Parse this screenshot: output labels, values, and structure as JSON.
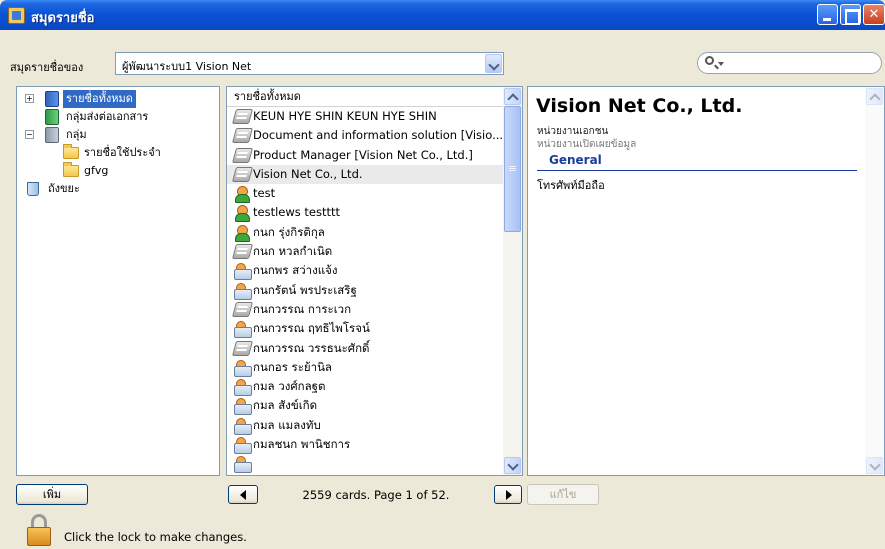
{
  "window": {
    "title": "สมุดรายชื่อ"
  },
  "addressbook": {
    "label": "สมุดรายชื่อของ",
    "selected": "ผู้พัฒนาระบบ1 Vision Net"
  },
  "groups": {
    "items": [
      {
        "label": "รายชื่อทั้งหมด",
        "selected": true
      },
      {
        "label": "กลุ่มส่งต่อเอกสาร"
      },
      {
        "label": "กลุ่ม"
      },
      {
        "label": "รายชื่อใช้ประจำ"
      },
      {
        "label": "gfvg"
      },
      {
        "label": "ถังขยะ"
      }
    ]
  },
  "contacts": {
    "header": "รายชื่อทั้งหมด",
    "rows": [
      {
        "name": "KEUN HYE SHIN KEUN HYE SHIN",
        "icon": "org-icon"
      },
      {
        "name": "Document and information solution [Visio...",
        "icon": "org-icon"
      },
      {
        "name": "Product Manager [Vision Net Co., Ltd.]",
        "icon": "org-icon"
      },
      {
        "name": "Vision Net Co., Ltd.",
        "icon": "org-icon",
        "highlight": true
      },
      {
        "name": "test",
        "icon": "person-icon"
      },
      {
        "name": "testlews testttt",
        "icon": "person-icon"
      },
      {
        "name": "กนก รุ่งกิรติกุล",
        "icon": "person-icon"
      },
      {
        "name": "กนก หวลกำเนิด",
        "icon": "org-icon"
      },
      {
        "name": "กนกพร สว่างแจ้ง",
        "icon": "card-icon"
      },
      {
        "name": "กนกรัตน์ พรประเสริฐ",
        "icon": "card-icon"
      },
      {
        "name": "กนกวรรณ การะเวก",
        "icon": "org-icon"
      },
      {
        "name": "กนกวรรณ ฤทธิไพโรจน์",
        "icon": "card-icon"
      },
      {
        "name": "กนกวรรณ วรรธนะศักดิ์",
        "icon": "org-icon"
      },
      {
        "name": "กนกอร ระย้านิล",
        "icon": "card-icon"
      },
      {
        "name": "กมล วงศ์กลฐต",
        "icon": "card-icon"
      },
      {
        "name": "กมล สังข์เกิด",
        "icon": "card-icon"
      },
      {
        "name": "กมล แมลงทับ",
        "icon": "card-icon"
      },
      {
        "name": "กมลชนก พานิชการ",
        "icon": "card-icon"
      },
      {
        "name": "",
        "icon": "card-icon"
      }
    ]
  },
  "detail": {
    "name": "Vision Net Co., Ltd.",
    "type": "หน่วยงานเอกชน",
    "visibility": "หน่วยงานเปิดเผยข้อมูล",
    "section": "General",
    "field_label": "โทรศัพท์มือถือ"
  },
  "footer": {
    "add_label": "เพิ่ม",
    "page_status": "2559 cards. Page 1 of 52.",
    "edit_label": "แก้ไข",
    "lock_text": "Click the lock to make changes."
  },
  "icons": {
    "minimize": "minimize-icon",
    "maximize": "maximize-icon",
    "close": "close-icon",
    "search": "search-icon",
    "lock": "lock-icon"
  },
  "colors": {
    "titlebar": "#0a54d8",
    "selection": "#316ac5",
    "section_heading": "#1a3c9c",
    "window_bg": "#ece9d8"
  }
}
